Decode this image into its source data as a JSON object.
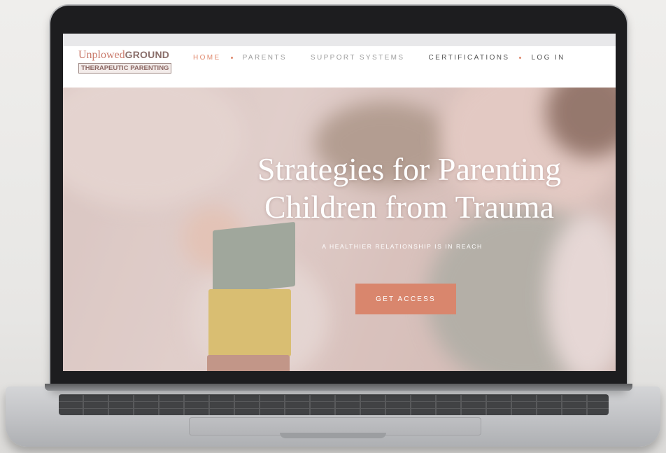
{
  "logo": {
    "name_light": "Unplowed",
    "name_bold": "GROUND",
    "tagline": "THERAPEUTIC PARENTING"
  },
  "nav": {
    "items": [
      {
        "label": "HOME"
      },
      {
        "label": "PARENTS"
      },
      {
        "label": "SUPPORT SYSTEMS"
      },
      {
        "label": "CERTIFICATIONS"
      },
      {
        "label": "LOG IN"
      }
    ]
  },
  "hero": {
    "title_line1": "Strategies for Parenting",
    "title_line2": "Children from Trauma",
    "subtitle": "A HEALTHIER RELATIONSHIP IS IN REACH",
    "cta_label": "GET ACCESS"
  },
  "colors": {
    "accent": "#d9866d",
    "logo_rose": "#c9796a",
    "nav_dark": "#545454",
    "nav_muted": "#9d9d9d"
  }
}
